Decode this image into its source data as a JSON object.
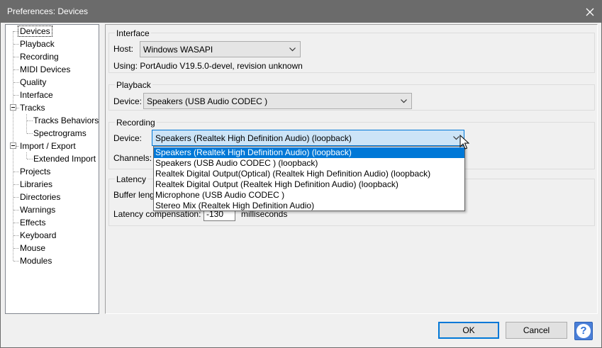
{
  "window": {
    "title": "Preferences: Devices"
  },
  "tree": {
    "items": [
      {
        "label": "Devices",
        "level": 0
      },
      {
        "label": "Playback",
        "level": 0
      },
      {
        "label": "Recording",
        "level": 0
      },
      {
        "label": "MIDI Devices",
        "level": 0
      },
      {
        "label": "Quality",
        "level": 0
      },
      {
        "label": "Interface",
        "level": 0
      },
      {
        "label": "Tracks",
        "level": 0
      },
      {
        "label": "Tracks Behaviors",
        "level": 1
      },
      {
        "label": "Spectrograms",
        "level": 1
      },
      {
        "label": "Import / Export",
        "level": 0
      },
      {
        "label": "Extended Import",
        "level": 1
      },
      {
        "label": "Projects",
        "level": 0
      },
      {
        "label": "Libraries",
        "level": 0
      },
      {
        "label": "Directories",
        "level": 0
      },
      {
        "label": "Warnings",
        "level": 0
      },
      {
        "label": "Effects",
        "level": 0
      },
      {
        "label": "Keyboard",
        "level": 0
      },
      {
        "label": "Mouse",
        "level": 0
      },
      {
        "label": "Modules",
        "level": 0
      }
    ]
  },
  "interface": {
    "title": "Interface",
    "host_label": "Host:",
    "host_value": "Windows WASAPI",
    "using_text": "Using: PortAudio V19.5.0-devel, revision unknown"
  },
  "playback": {
    "title": "Playback",
    "device_label": "Device:",
    "device_value": "Speakers (USB Audio CODEC )"
  },
  "recording": {
    "title": "Recording",
    "device_label": "Device:",
    "device_value": "Speakers (Realtek High Definition Audio) (loopback)",
    "channels_label": "Channels:",
    "options": [
      "Speakers (Realtek High Definition Audio) (loopback)",
      "Speakers (USB Audio CODEC ) (loopback)",
      "Realtek Digital Output(Optical) (Realtek High Definition Audio) (loopback)",
      "Realtek Digital Output (Realtek High Definition Audio) (loopback)",
      "Microphone (USB Audio CODEC )",
      "Stereo Mix (Realtek High Definition Audio)"
    ]
  },
  "latency": {
    "title": "Latency",
    "buffer_label": "Buffer leng",
    "compensation_label": "Latency compensation:",
    "compensation_value": "-130",
    "compensation_unit": "milliseconds"
  },
  "buttons": {
    "ok": "OK",
    "cancel": "Cancel",
    "help": "?"
  },
  "colors": {
    "accent": "#0078d7",
    "titlebar": "#6b6b6b",
    "help_bg": "#4a7fd8"
  }
}
